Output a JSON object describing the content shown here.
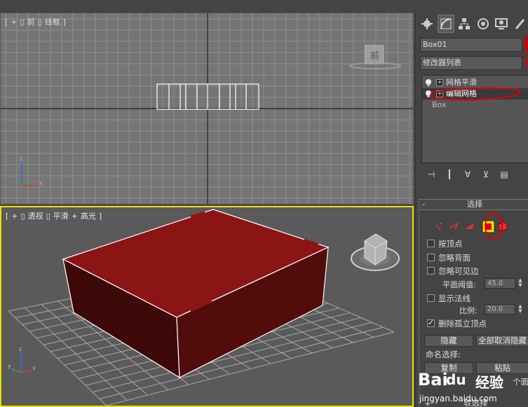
{
  "viewports": {
    "front": {
      "bracket_open": "[",
      "plus": "+",
      "sep1": "▯",
      "name": "前",
      "sep2": "▯",
      "mode": "线框",
      "bracket_close": "]",
      "viewcube_label": "前"
    },
    "perspective": {
      "bracket_open": "[",
      "plus": "+",
      "sep1": "▯",
      "name": "透视",
      "sep2": "▯",
      "shading": "平滑",
      "plus2": "+",
      "light": "高光",
      "bracket_close": "]"
    },
    "axis_labels": {
      "x": "x",
      "y": "y",
      "z": "z"
    }
  },
  "panel": {
    "object_name": "Box01",
    "modifier_list": "修改器列表",
    "stack": [
      {
        "label": "网格平滑"
      },
      {
        "label": "编辑网格"
      },
      {
        "label": "Box"
      }
    ],
    "rollout_title": "选择",
    "rollout_minus": "-",
    "checkboxes": {
      "by_vertex": "按顶点",
      "ignore_backfacing": "忽略背面",
      "ignore_visible_edges": "忽略可见边",
      "show_normals": "显示法线",
      "delete_isolated": "删除孤立顶点"
    },
    "planar_threshold_label": "平面阈值:",
    "planar_threshold_value": "45.0",
    "scale_label": "比例:",
    "scale_value": "20.0",
    "hide_button": "隐藏",
    "unhide_all_button": "全部取消隐藏",
    "named_selection_label": "命名选择:",
    "copy_button": "复制",
    "paste_button": "粘贴",
    "partial_text": "个面",
    "next_rollout_plus": "+",
    "next_rollout_title": "软选择"
  },
  "watermark": {
    "brand": "Bai",
    "paw": "du",
    "cn": "经验",
    "url": "jingyan.baidu.com"
  },
  "colors": {
    "box_red": "#8b1414",
    "active_border": "#e8e200",
    "annotation_red": "#e00000",
    "highlight_yellow": "#f0e000"
  }
}
